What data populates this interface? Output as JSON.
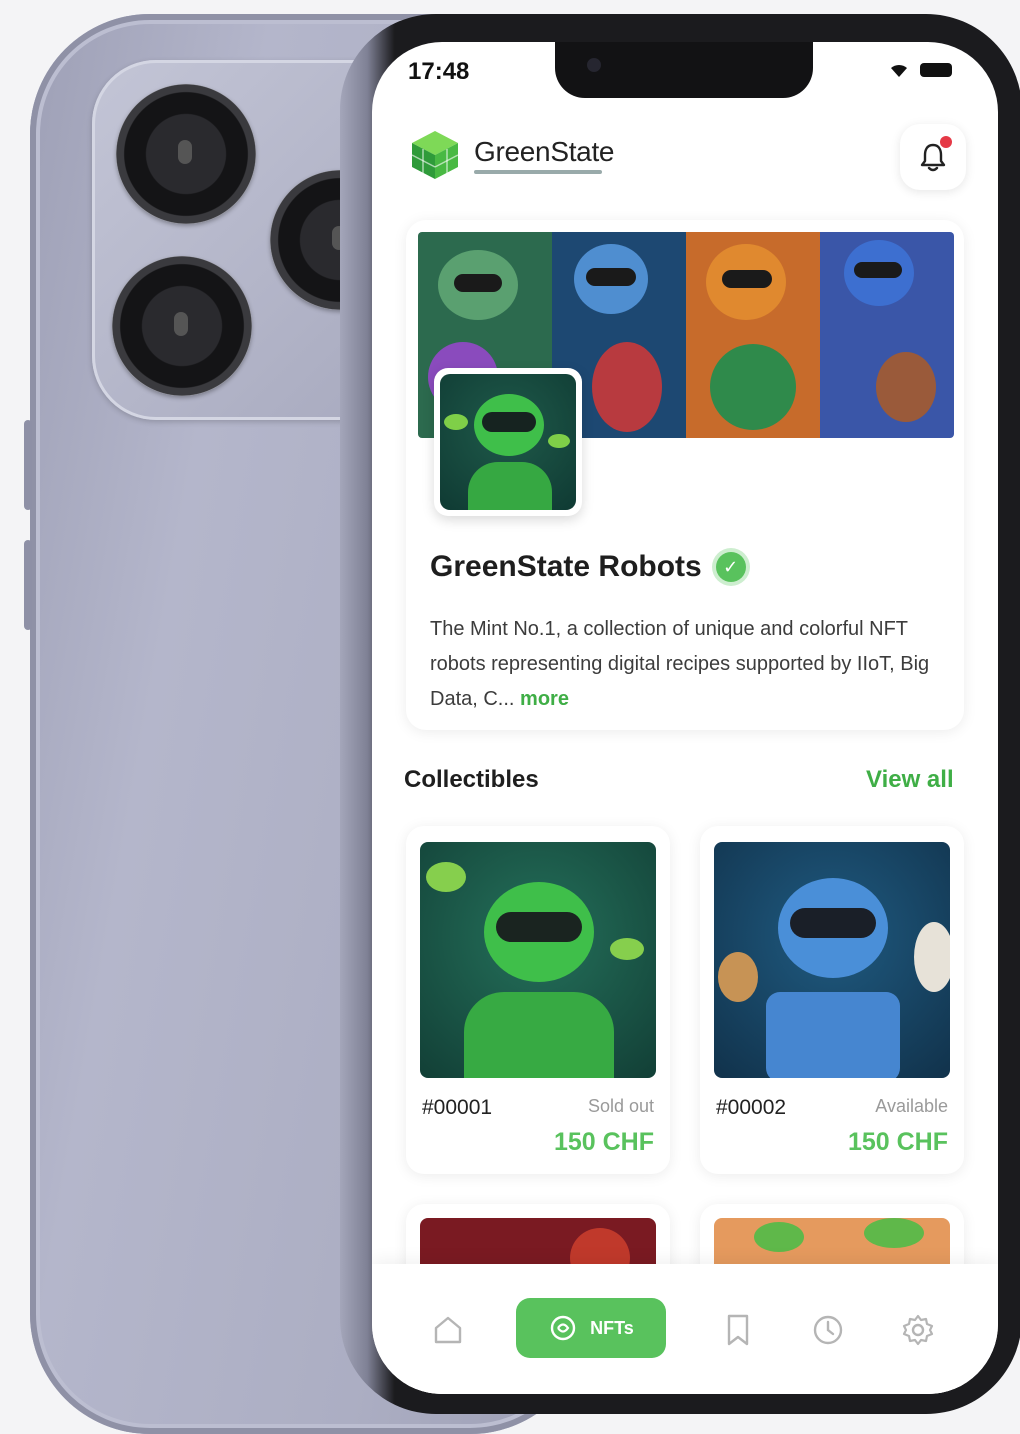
{
  "status_bar": {
    "time": "17:48"
  },
  "header": {
    "brand_name": "GreenState",
    "logo_icon": "green-cube-logo",
    "notification_icon": "bell-icon"
  },
  "collection": {
    "title": "GreenState Robots",
    "verified_icon": "verified-check-icon",
    "description": "The Mint No.1, a collection of unique and colorful NFT robots representing digital recipes supported by IIoT, Big Data, C...",
    "more_label": "more"
  },
  "collectibles": {
    "section_title": "Collectibles",
    "view_all_label": "View all",
    "items": [
      {
        "id": "#00001",
        "status": "Sold out",
        "price": "150 CHF",
        "robot_color": "#3fbf4a",
        "bg_color": "#1a5546"
      },
      {
        "id": "#00002",
        "status": "Available",
        "price": "150 CHF",
        "robot_color": "#4a8fd8",
        "bg_color": "#1b4d6b"
      }
    ]
  },
  "bottom_nav": {
    "items": [
      {
        "icon": "home-icon"
      },
      {
        "icon": "nft-icon",
        "label": "NFTs",
        "active": true
      },
      {
        "icon": "bookmark-icon"
      },
      {
        "icon": "clock-icon"
      },
      {
        "icon": "settings-gear-icon"
      }
    ]
  },
  "colors": {
    "accent": "#59c25d",
    "accent_text": "#3fae46",
    "notification_dot": "#e53946"
  }
}
